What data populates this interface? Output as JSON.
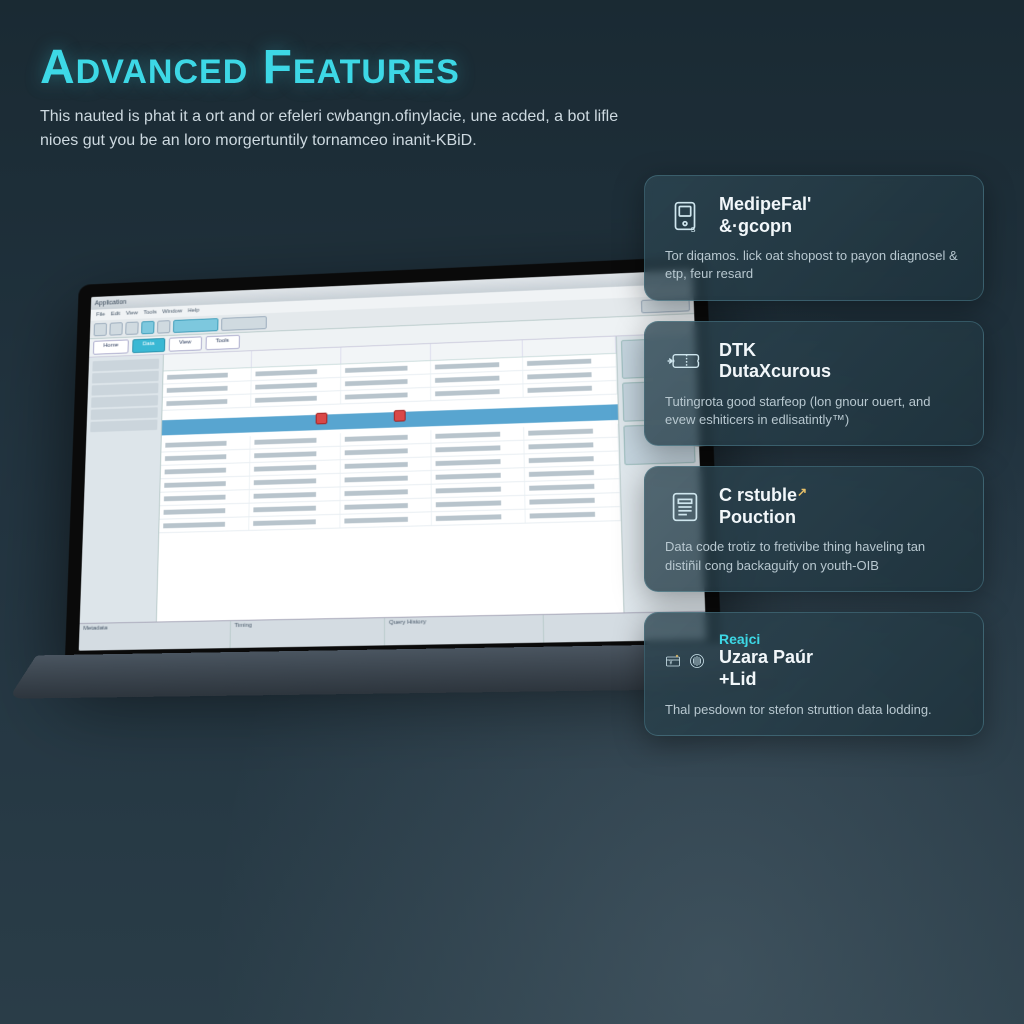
{
  "header": {
    "title": "Advanced Features",
    "subtitle": "This nauted is phat it a ort and or efeleri cwbangn.ofinylacie, une acded, a bot lifle nioes gut you be an loro morgertuntily tornamceo inanit-KBiD."
  },
  "cards": [
    {
      "title_a": "MedipeFal'",
      "title_b": "&·gcopn",
      "body": "Tor diqamos. lick oat shopost to payon diagnosel & etp, feur resard",
      "icon": "device"
    },
    {
      "title_a": "DTK",
      "title_b": "DutaXcurous",
      "body": "Tutingrota good starfeop (lon gnour ouert, and evew eshiticers in edlisatintly™)",
      "icon": "ticket"
    },
    {
      "title_a": "C rstuble",
      "title_b": "Pouction",
      "body": "Data code trotiz to fretivibe thing haveling tan distiñil cong backaguify on youth-OIB",
      "icon": "file",
      "corner": "↗"
    },
    {
      "title_a": "Uzara Paúr",
      "title_b": "+Lid",
      "body": "Thal pesdown tor stefon struttion data lodding.",
      "icon": "dual",
      "pre": "Reajci"
    }
  ],
  "app": {
    "window_title": "Application",
    "menu": [
      "File",
      "Edit",
      "View",
      "Tools",
      "Window",
      "Help"
    ],
    "ribbon": [
      "Home",
      "Data",
      "View",
      "Tools"
    ],
    "status": [
      "Metadata",
      "Timing",
      "Query History",
      ""
    ]
  }
}
